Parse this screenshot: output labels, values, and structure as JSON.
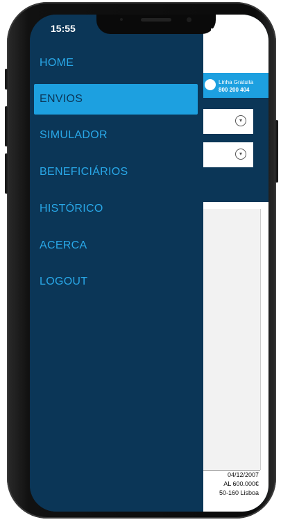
{
  "status_bar": {
    "time": "15:55"
  },
  "menu": {
    "items": [
      {
        "label": "HOME",
        "active": false
      },
      {
        "label": "ENVIOS",
        "active": true
      },
      {
        "label": "SIMULADOR",
        "active": false
      },
      {
        "label": "BENEFICIÁRIOS",
        "active": false
      },
      {
        "label": "HISTÓRICO",
        "active": false
      },
      {
        "label": "ACERCA",
        "active": false
      },
      {
        "label": "LOGOUT",
        "active": false
      }
    ]
  },
  "background_app": {
    "header_line1": "Linha Gratuita",
    "header_line2": "800 200 404",
    "footer_lines": [
      "04/12/2007",
      "AL 600.000€",
      "50-160 Lisboa"
    ]
  },
  "colors": {
    "drawer_bg": "#0b3657",
    "menu_text": "#29a8e8",
    "active_bg": "#1da0e0"
  }
}
